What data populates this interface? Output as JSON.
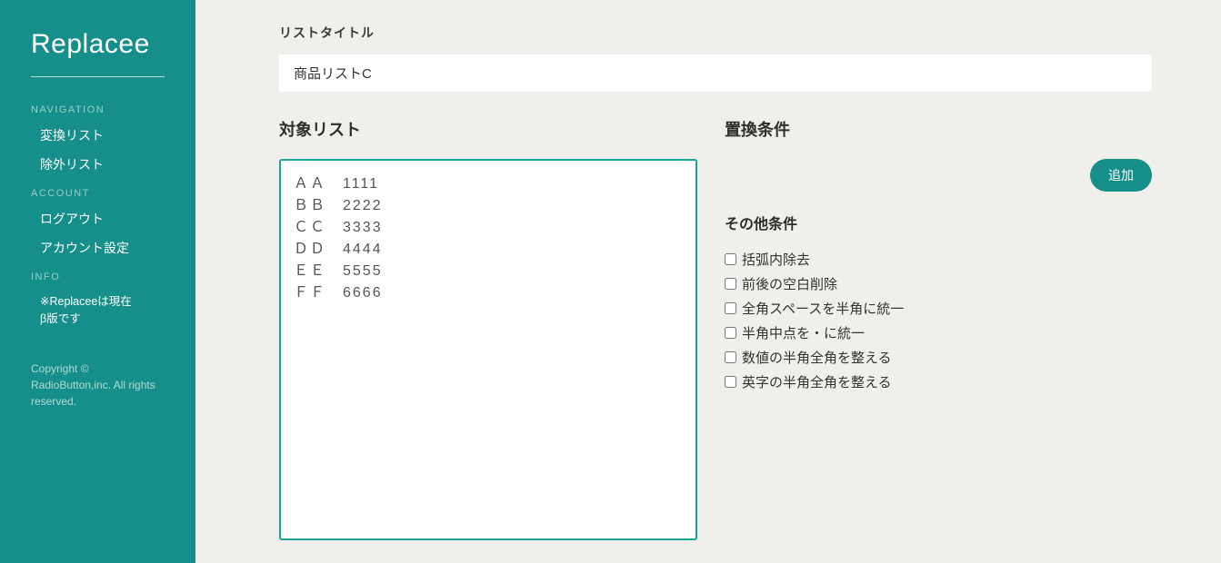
{
  "brand": "Replacee",
  "sidebar": {
    "sections": [
      {
        "heading": "NAVIGATION",
        "items": [
          "変換リスト",
          "除外リスト"
        ]
      },
      {
        "heading": "ACCOUNT",
        "items": [
          "ログアウト",
          "アカウント設定"
        ]
      },
      {
        "heading": "INFO",
        "info": "※Replaceeは現在β版です"
      }
    ],
    "copyright": "Copyright © RadioButton,inc. All rights reserved."
  },
  "main": {
    "list_title_label": "リストタイトル",
    "list_title_value": "商品リストC",
    "target_list_label": "対象リスト",
    "target_list_value": "ＡＡ　1111\nＢＢ　2222\nＣＣ　3333\nＤＤ　4444\nＥＥ　5555\nＦＦ　6666",
    "replace_cond_label": "置換条件",
    "add_button": "追加",
    "other_cond_label": "その他条件",
    "checkboxes": [
      "括弧内除去",
      "前後の空白削除",
      "全角スペースを半角に統一",
      "半角中点を・に統一",
      "数値の半角全角を整える",
      "英字の半角全角を整える"
    ]
  }
}
